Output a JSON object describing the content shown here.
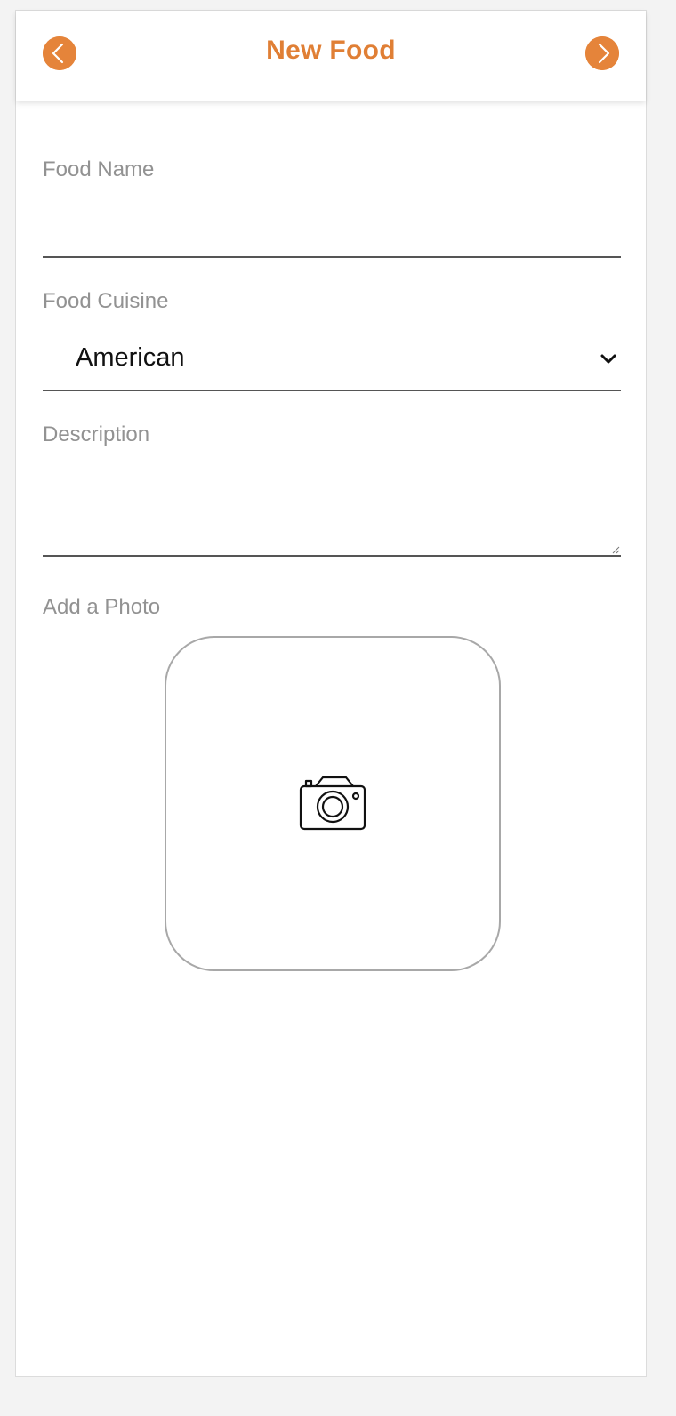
{
  "header": {
    "title": "New Food",
    "back_icon": "chevron-left-icon",
    "next_icon": "chevron-right-icon",
    "accent_color": "#e5843a"
  },
  "form": {
    "food_name": {
      "label": "Food Name",
      "value": ""
    },
    "food_cuisine": {
      "label": "Food Cuisine",
      "selected": "American",
      "icon": "chevron-down-icon"
    },
    "description": {
      "label": "Description",
      "value": ""
    },
    "photo": {
      "label": "Add a Photo",
      "icon": "camera-icon"
    }
  }
}
